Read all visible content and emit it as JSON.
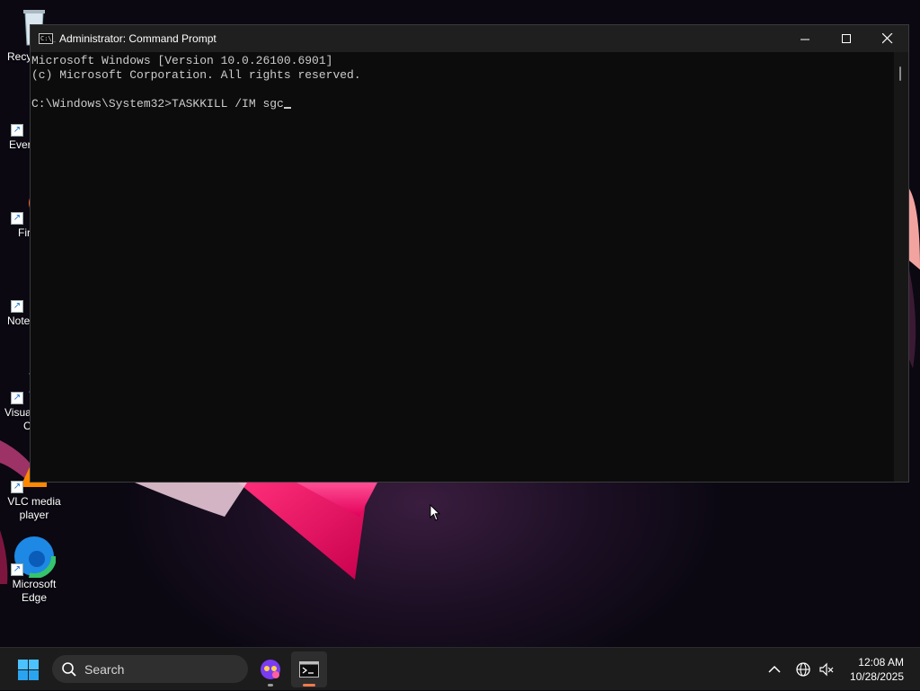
{
  "desktop": {
    "icons": [
      {
        "name": "recycle-bin-icon",
        "label": "Recy"
      },
      {
        "name": "everything-icon",
        "label": "Ever"
      },
      {
        "name": "firefox-icon",
        "label": "Fir"
      },
      {
        "name": "notepad-icon",
        "label": "Note"
      },
      {
        "name": "vscode-icon",
        "label_line1": "Visua",
        "label_line2": "C"
      },
      {
        "name": "vlc-icon",
        "label_line1": "VLC media",
        "label_line2": "player"
      },
      {
        "name": "edge-icon",
        "label_line1": "Microsoft",
        "label_line2": "Edge"
      }
    ]
  },
  "window": {
    "title": "Administrator: Command Prompt",
    "app_icon_text": "C:\\_",
    "buttons": {
      "minimize": "minimize",
      "maximize": "maximize",
      "close": "close"
    }
  },
  "terminal": {
    "line1": "Microsoft Windows [Version 10.0.26100.6901]",
    "line2": "(c) Microsoft Corporation. All rights reserved.",
    "line3": "",
    "prompt": "C:\\Windows\\System32>",
    "command": "TASKKILL /IM sgc"
  },
  "taskbar": {
    "search_placeholder": "Search",
    "clock_time": "12:08 AM",
    "clock_date": "10/28/2025",
    "apps": [
      {
        "name": "copilot-app-icon"
      },
      {
        "name": "command-prompt-app-icon",
        "active": true
      }
    ]
  },
  "colors": {
    "terminal_bg": "#0c0c0c",
    "terminal_fg": "#cccccc",
    "taskbar_bg": "#1c1c1c",
    "active_indicator": "#f07a4b",
    "start_blue": "#4cc2ff"
  }
}
